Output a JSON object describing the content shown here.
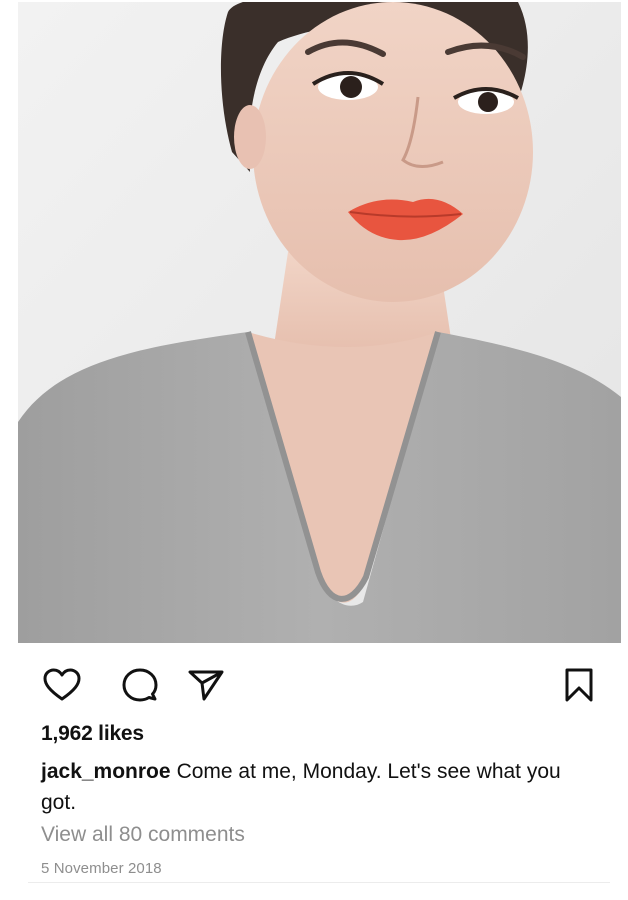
{
  "post": {
    "image": {
      "description_icon": "photo"
    },
    "actions": {
      "like_icon": "heart-icon",
      "comment_icon": "comment-bubble-icon",
      "share_icon": "paper-plane-icon",
      "save_icon": "bookmark-icon"
    },
    "likes": "1,962 likes",
    "username": "jack_monroe",
    "caption": "Come at me, Monday. Let's see what you got.",
    "view_comments": "View all 80 comments",
    "date": "5 November 2018"
  },
  "colors": {
    "text": "#111111",
    "muted": "#8e8e8e",
    "lip": "#e8553f",
    "sweater": "#a9a9a9",
    "wall": "#ebebeb"
  }
}
